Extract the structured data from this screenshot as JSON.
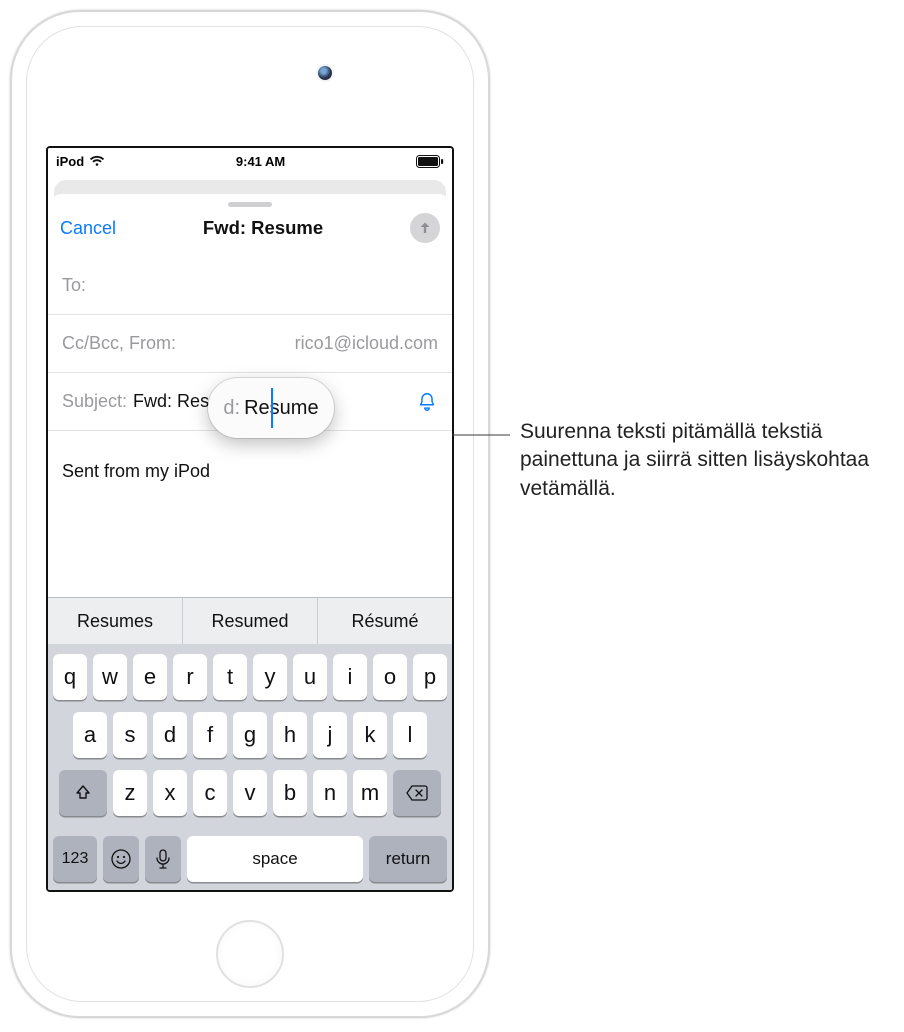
{
  "status": {
    "device": "iPod",
    "time": "9:41 AM"
  },
  "nav": {
    "cancel": "Cancel",
    "title": "Fwd:  Resume"
  },
  "fields": {
    "to_label": "To:",
    "ccbcc_label": "Cc/Bcc, From:",
    "ccbcc_value": "rico1@icloud.com",
    "subject_label": "Subject:",
    "subject_value": "Fwd:  Resume"
  },
  "loupe": {
    "label": "d:",
    "text": "Resume"
  },
  "body": {
    "signature": "Sent from my iPod"
  },
  "suggestions": [
    "Resumes",
    "Resumed",
    "Résumé"
  ],
  "keys": {
    "row1": [
      "q",
      "w",
      "e",
      "r",
      "t",
      "y",
      "u",
      "i",
      "o",
      "p"
    ],
    "row2": [
      "a",
      "s",
      "d",
      "f",
      "g",
      "h",
      "j",
      "k",
      "l"
    ],
    "row3": [
      "z",
      "x",
      "c",
      "v",
      "b",
      "n",
      "m"
    ],
    "numbers": "123",
    "space": "space",
    "return": "return"
  },
  "callout": "Suurenna teksti pitämällä tekstiä painettuna ja siirrä sitten lisäyskohtaa vetämällä."
}
